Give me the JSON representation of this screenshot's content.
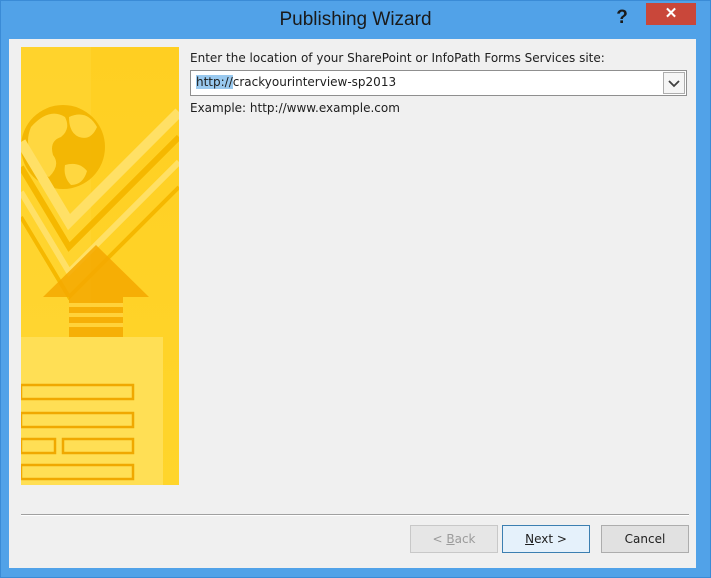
{
  "window": {
    "title": "Publishing Wizard",
    "help_label": "?",
    "close_label": "✕"
  },
  "main": {
    "site_label": "Enter the location of your SharePoint or InfoPath Forms Services site:",
    "url_value_selected": "http://",
    "url_value_rest": "crackyourinterview-sp2013",
    "example_text": "Example: http://www.example.com"
  },
  "buttons": {
    "back_prefix": "< ",
    "back_key": "B",
    "back_rest": "ack",
    "next_key": "N",
    "next_rest": "ext >",
    "cancel_label": "Cancel"
  },
  "colors": {
    "title_bar": "#51a2e8",
    "close_button": "#c9473a",
    "client_background": "#f0f0f0",
    "banner_yellow": "#ffc91a"
  },
  "icons": {
    "banner": "globe-arrow-form-illustration",
    "dropdown": "chevron-down-icon"
  }
}
